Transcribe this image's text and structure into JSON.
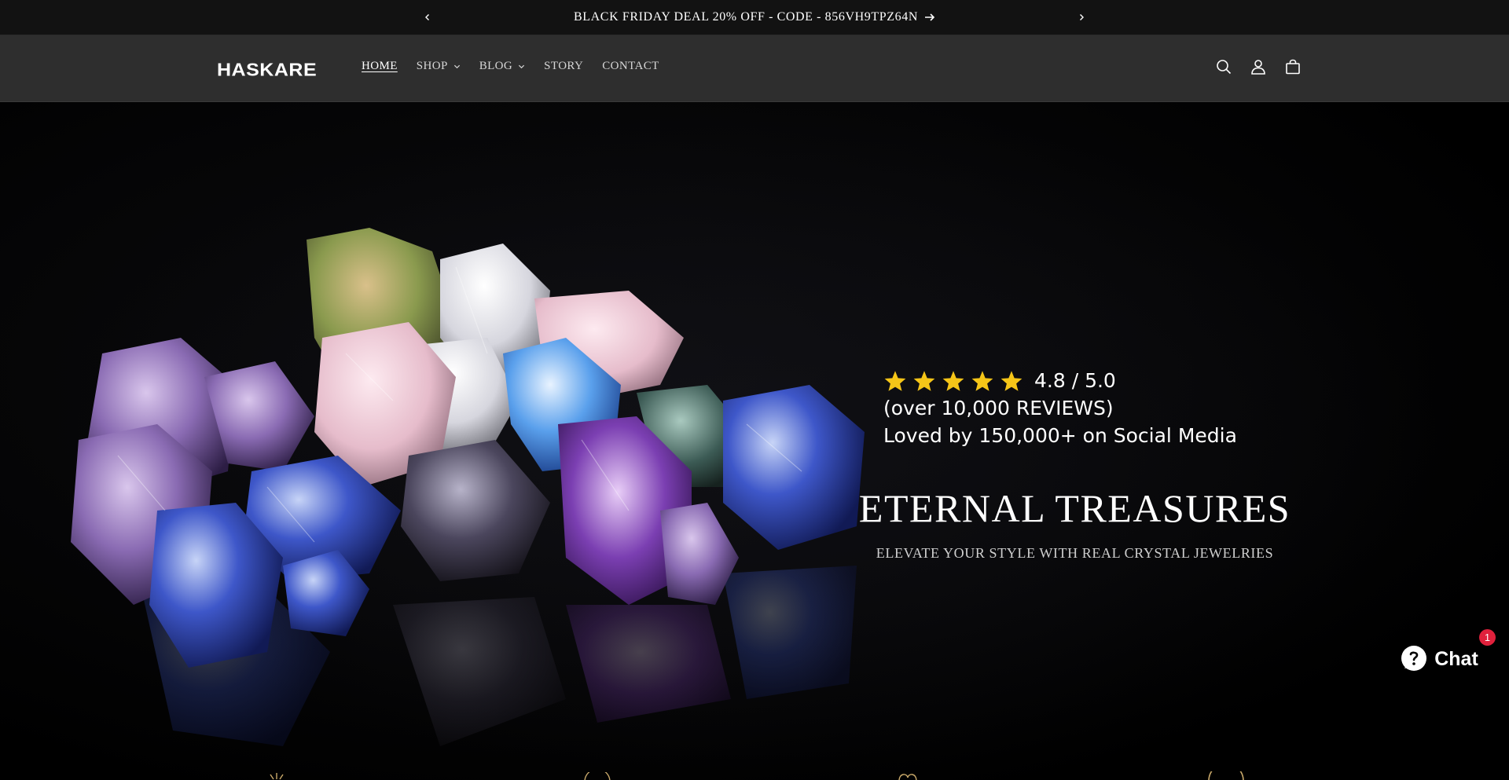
{
  "announcement": {
    "message": "BLACK FRIDAY DEAL 20% OFF - CODE - 856VH9TPZ64N",
    "prev_icon": "chevron-left-icon",
    "next_icon": "chevron-right-icon",
    "arrow_icon": "arrow-right-icon"
  },
  "header": {
    "logo": "HASKARE",
    "nav": [
      {
        "label": "HOME",
        "active": true,
        "dropdown": false
      },
      {
        "label": "SHOP",
        "active": false,
        "dropdown": true
      },
      {
        "label": "BLOG",
        "active": false,
        "dropdown": true
      },
      {
        "label": "STORY",
        "active": false,
        "dropdown": false
      },
      {
        "label": "CONTACT",
        "active": false,
        "dropdown": false
      }
    ],
    "icons": [
      "search-icon",
      "account-icon",
      "cart-icon"
    ]
  },
  "hero": {
    "rating": "4.8 / 5.0",
    "stars": 5,
    "reviews_line": "(over 10,000 REVIEWS)",
    "social_line": "Loved by 150,000+ on Social Media",
    "title": "ETERNAL TREASURES",
    "subtitle": "ELEVATE YOUR STYLE WITH REAL CRYSTAL JEWELRIES",
    "image": "crystals-image"
  },
  "chat": {
    "label": "Chat",
    "badge": "1",
    "icon": "chat-bubble-icon"
  },
  "colors": {
    "announcement_bg": "#121212",
    "header_bg": "#2e2e2e",
    "star": "#f5c518",
    "badge": "#e0213c"
  }
}
